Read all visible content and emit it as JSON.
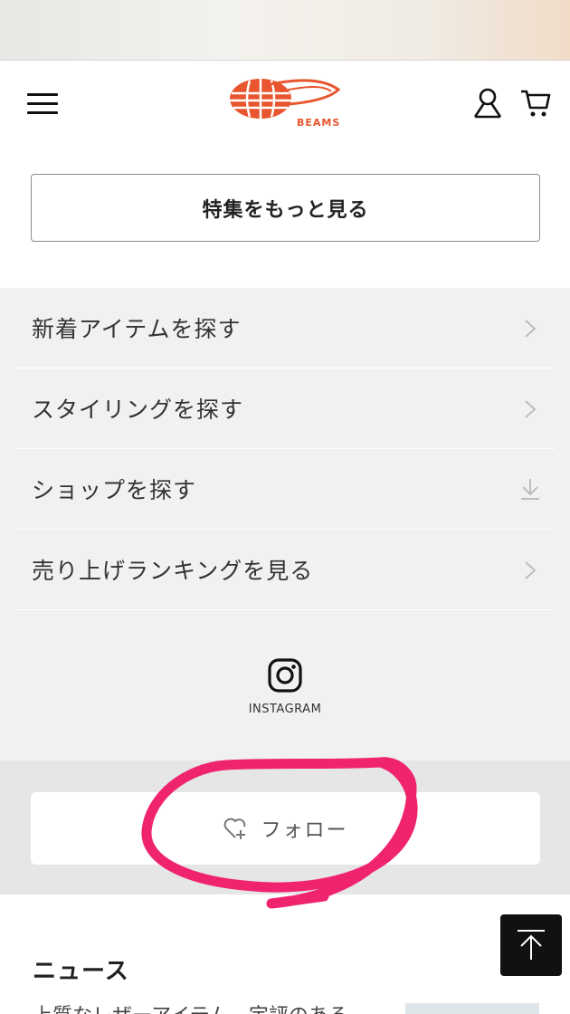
{
  "header": {
    "logo_text": "BEAMS",
    "brand_color": "#e8552e"
  },
  "feature": {
    "button_label": "特集をもっと見る"
  },
  "menu": {
    "items": [
      {
        "label": "新着アイテムを探す",
        "icon": "chevron-right-icon"
      },
      {
        "label": "スタイリングを探す",
        "icon": "chevron-right-icon"
      },
      {
        "label": "ショップを探す",
        "icon": "arrow-down-icon"
      },
      {
        "label": "売り上げランキングを見る",
        "icon": "chevron-right-icon"
      }
    ]
  },
  "instagram": {
    "label": "INSTAGRAM"
  },
  "follow": {
    "label": "フォロー"
  },
  "news": {
    "title": "ニュース",
    "snippet": "上質なレザーアイテム、定評のある"
  },
  "annotation_color": "#f0246e"
}
